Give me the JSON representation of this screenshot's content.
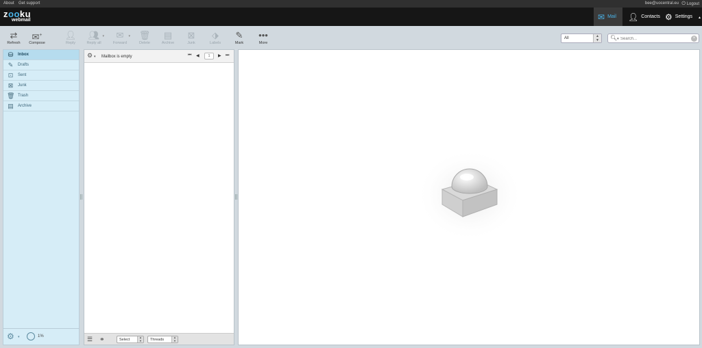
{
  "topbar": {
    "about": "About",
    "support": "Get support",
    "user": "bee@uocentral.eu",
    "logout": "Logout"
  },
  "logo": {
    "brand_a": "z",
    "brand_o1": "o",
    "brand_o2": "o",
    "brand_b": "ku",
    "sub": "webmail"
  },
  "nav": {
    "mail": "Mail",
    "contacts": "Contacts",
    "settings": "Settings"
  },
  "toolbar": {
    "refresh": "Refresh",
    "compose": "Compose",
    "reply": "Reply",
    "reply_all": "Reply all",
    "forward": "Forward",
    "delete": "Delete",
    "archive": "Archive",
    "junk": "Junk",
    "labels": "Labels",
    "mark": "Mark",
    "more": "More"
  },
  "filter": {
    "value": "All"
  },
  "search": {
    "placeholder": "Search..."
  },
  "folders": [
    {
      "label": "Inbox",
      "icon": "inbox-icon",
      "active": true
    },
    {
      "label": "Drafts",
      "icon": "pencil-icon",
      "active": false
    },
    {
      "label": "Sent",
      "icon": "sent-icon",
      "active": false
    },
    {
      "label": "Junk",
      "icon": "junk-icon",
      "active": false
    },
    {
      "label": "Trash",
      "icon": "trash-icon",
      "active": false
    },
    {
      "label": "Archive",
      "icon": "archive-icon",
      "active": false
    }
  ],
  "quota": {
    "value": "1%"
  },
  "list": {
    "status": "Mailbox is empty",
    "page": "1",
    "select_label": "Select",
    "threads_label": "Threads"
  },
  "colors": {
    "accent": "#4ab3e8",
    "folder_bg": "#d6edf7",
    "header_bg": "#161616"
  }
}
